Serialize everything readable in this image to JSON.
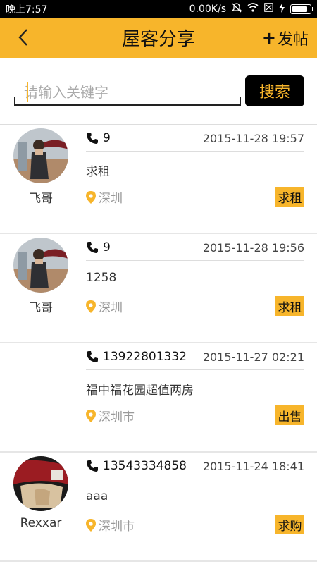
{
  "status_bar": {
    "time": "晚上7:57",
    "network_speed": "0.00K/s",
    "icons": [
      "mute-icon",
      "wifi-icon",
      "sim-icon",
      "charging-icon",
      "battery-icon"
    ],
    "battery_level": 0.9
  },
  "header": {
    "title": "屋客分享",
    "back_icon": "chevron-left-icon",
    "post_plus": "+",
    "post_label": "发帖"
  },
  "search": {
    "placeholder": "请输入关键字",
    "value": "",
    "button_label": "搜索"
  },
  "colors": {
    "accent": "#f7b52b",
    "black": "#000000",
    "muted_text": "#999999"
  },
  "listings": [
    {
      "avatar": "avatar-person-umbrella",
      "username": "飞哥",
      "phone": "9",
      "date": "2015-11-28 19:57",
      "content": "求租",
      "location": "深圳",
      "tag": "求租"
    },
    {
      "avatar": "avatar-person-umbrella",
      "username": "飞哥",
      "phone": "9",
      "date": "2015-11-28 19:56",
      "content": "1258",
      "location": "深圳",
      "tag": "求租"
    },
    {
      "avatar": "",
      "username": "",
      "phone": "13922801332",
      "date": "2015-11-27 02:21",
      "content": "福中福花园超值两房",
      "location": "深圳市",
      "tag": "出售"
    },
    {
      "avatar": "avatar-car-interior",
      "username": "Rexxar",
      "phone": "13543334858",
      "date": "2015-11-24 18:41",
      "content": "aaa",
      "location": "深圳市",
      "tag": "求购"
    }
  ]
}
